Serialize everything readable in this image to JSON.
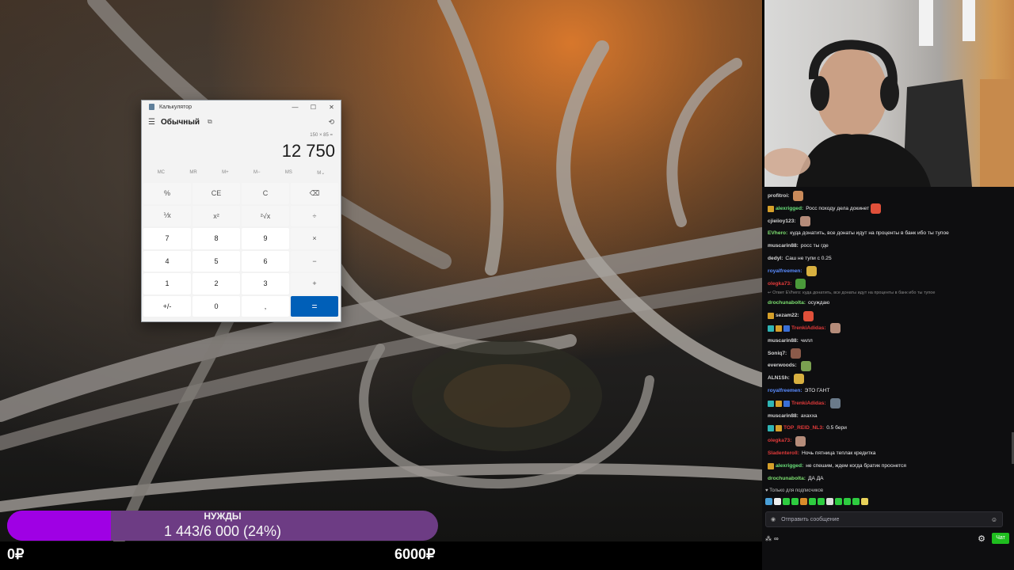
{
  "calculator": {
    "title": "Калькулятор",
    "mode": "Обычный",
    "expression": "150 × 85 =",
    "result": "12 750",
    "window_buttons": {
      "minimize": "—",
      "maximize": "☐",
      "close": "✕"
    },
    "memory_buttons": [
      "MC",
      "MR",
      "M+",
      "M−",
      "MS",
      "M⌄"
    ],
    "keys": [
      {
        "label": "%",
        "type": "op"
      },
      {
        "label": "CE",
        "type": "op"
      },
      {
        "label": "C",
        "type": "op"
      },
      {
        "label": "⌫",
        "type": "op"
      },
      {
        "label": "⅟x",
        "type": "op"
      },
      {
        "label": "x²",
        "type": "op"
      },
      {
        "label": "²√x",
        "type": "op"
      },
      {
        "label": "÷",
        "type": "op"
      },
      {
        "label": "7",
        "type": "num"
      },
      {
        "label": "8",
        "type": "num"
      },
      {
        "label": "9",
        "type": "num"
      },
      {
        "label": "×",
        "type": "op"
      },
      {
        "label": "4",
        "type": "num"
      },
      {
        "label": "5",
        "type": "num"
      },
      {
        "label": "6",
        "type": "num"
      },
      {
        "label": "−",
        "type": "op"
      },
      {
        "label": "1",
        "type": "num"
      },
      {
        "label": "2",
        "type": "num"
      },
      {
        "label": "3",
        "type": "num"
      },
      {
        "label": "+",
        "type": "op"
      },
      {
        "label": "+/-",
        "type": "num"
      },
      {
        "label": "0",
        "type": "num"
      },
      {
        "label": ",",
        "type": "num"
      },
      {
        "label": "=",
        "type": "eq"
      }
    ]
  },
  "goal": {
    "title": "НУЖДЫ",
    "amount": "1 443/6 000 (24%)",
    "progress": 0.24,
    "min_label": "0₽",
    "max_label": "6000₽",
    "fill_color": "#9f00e4",
    "track_color": "#6d3c84"
  },
  "chat": {
    "messages": [
      {
        "user": "profitroi:",
        "color": "#d6d6d6",
        "text": "",
        "emote": true,
        "badges": []
      },
      {
        "user": "alexrigged:",
        "color": "#69e07a",
        "text": "Росс походу дела докинет",
        "emote": true,
        "badges": [
          "#d6a02a"
        ]
      },
      {
        "user": "cjieiioy123:",
        "color": "#d6d6d6",
        "text": "",
        "emote": true,
        "badges": []
      },
      {
        "user": "EVhero:",
        "color": "#7de070",
        "text": "куда донатить, все донаты идут на проценты в банк ибо ты тупое",
        "emote": false,
        "badges": []
      },
      {
        "user": "muscarin88:",
        "color": "#d6d6d6",
        "text": "росс ты где",
        "emote": false,
        "badges": []
      },
      {
        "user": "dedyl:",
        "color": "#d6d6d6",
        "text": "Саш не тупи с 0.25",
        "emote": false,
        "badges": []
      },
      {
        "user": "royalfreemen:",
        "color": "#5a8cff",
        "text": "",
        "emote": true,
        "badges": []
      },
      {
        "user": "olegka73:",
        "color": "#e23a3a",
        "text": "",
        "emote": true,
        "badges": []
      },
      {
        "user": "",
        "color": "#8a8a8a",
        "text": "↩ Ответ EVhero: куда донатить, все донаты идут на проценты в банк ибо ты тупое",
        "emote": false,
        "badges": [],
        "reply": true
      },
      {
        "user": "drochunabolta:",
        "color": "#7de070",
        "text": "осуждаю",
        "emote": false,
        "badges": []
      },
      {
        "user": "sezam22:",
        "color": "#d6d6d6",
        "text": "",
        "emote": true,
        "badges": [
          "#d6a02a"
        ]
      },
      {
        "user": "TrenkiAdidas:",
        "color": "#e23a3a",
        "text": "",
        "emote": true,
        "badges": [
          "#2fb5b5",
          "#d6a02a",
          "#3a6fd6"
        ]
      },
      {
        "user": "muscarin88:",
        "color": "#d6d6d6",
        "text": "чилл",
        "emote": false,
        "badges": []
      },
      {
        "user": "Soniq7:",
        "color": "#d6d6d6",
        "text": "",
        "emote": true,
        "badges": []
      },
      {
        "user": "everwoods:",
        "color": "#d6d6d6",
        "text": "",
        "emote": true,
        "badges": []
      },
      {
        "user": "ALN1Sh:",
        "color": "#d6d6d6",
        "text": "",
        "emote": true,
        "badges": []
      },
      {
        "user": "royalfreemen:",
        "color": "#5a8cff",
        "text": "ЭТО ГАНТ",
        "emote": false,
        "badges": []
      },
      {
        "user": "TrenkiAdidas:",
        "color": "#e23a3a",
        "text": "",
        "emote": true,
        "badges": [
          "#2fb5b5",
          "#d6a02a",
          "#3a6fd6"
        ]
      },
      {
        "user": "muscarin88:",
        "color": "#d6d6d6",
        "text": "ахахха",
        "emote": false,
        "badges": []
      },
      {
        "user": "TOP_REID_NL3:",
        "color": "#e23a3a",
        "text": "0.5 бери",
        "emote": false,
        "badges": [
          "#2fb5b5",
          "#d6a02a"
        ]
      },
      {
        "user": "olegka73:",
        "color": "#e23a3a",
        "text": "",
        "emote": true,
        "badges": []
      },
      {
        "user": "Sladenteroll:",
        "color": "#e23a3a",
        "text": "Ночь пятница теплак кредитка",
        "emote": false,
        "badges": []
      },
      {
        "user": "alexrigged:",
        "color": "#69e07a",
        "text": "не спешим, ждем когда братик проснется",
        "emote": false,
        "badges": [
          "#d6a02a"
        ]
      },
      {
        "user": "drochunabolta:",
        "color": "#7de070",
        "text": "ДА ДА",
        "emote": false,
        "badges": []
      }
    ],
    "subs_only_label": "♥ Только для подписчиков",
    "input_placeholder": "Отправить сообщение",
    "bits_label": "∞",
    "chat_button": "Чат"
  }
}
